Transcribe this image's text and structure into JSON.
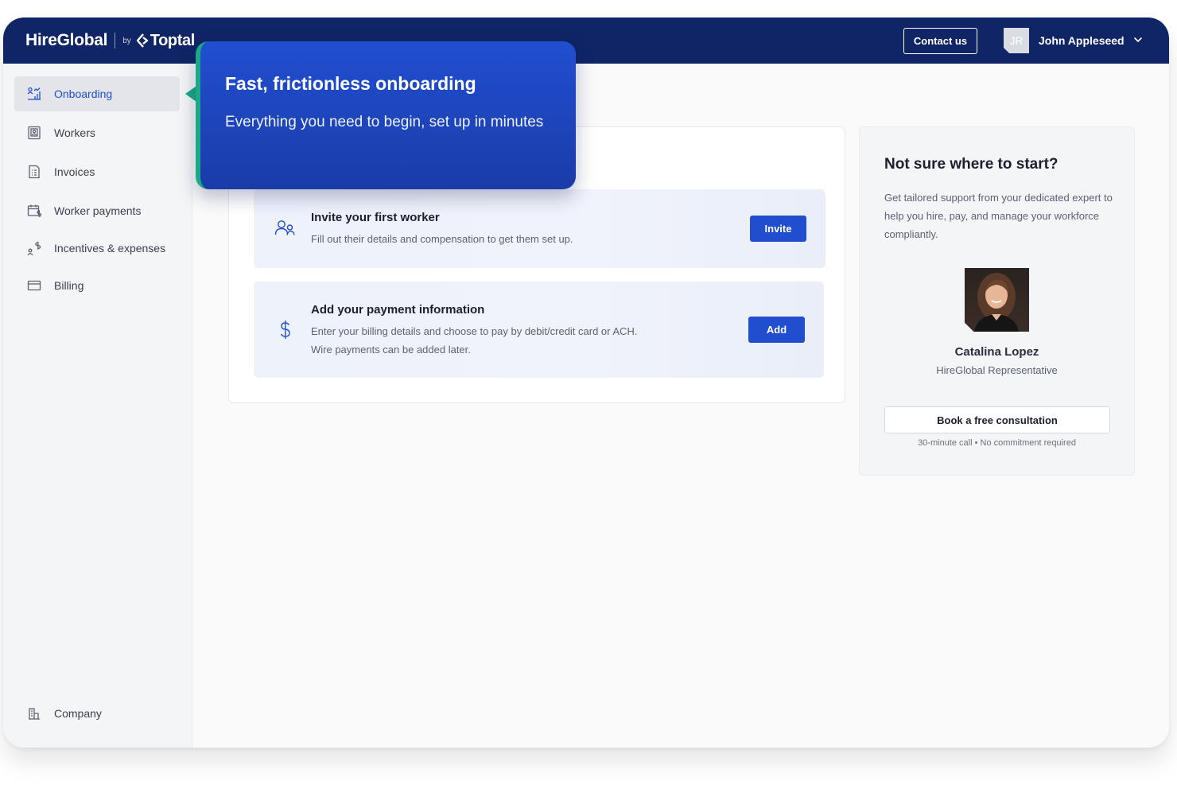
{
  "header": {
    "brand": "HireGlobal",
    "by": "by",
    "partner": "Toptal",
    "contact_label": "Contact us",
    "avatar_initials": "JR",
    "user_name": "John Appleseed"
  },
  "sidebar": {
    "items": [
      {
        "label": "Onboarding",
        "icon": "onboarding-chart-icon",
        "active": true
      },
      {
        "label": "Workers",
        "icon": "workers-id-icon"
      },
      {
        "label": "Invoices",
        "icon": "invoice-document-icon"
      },
      {
        "label": "Worker payments",
        "icon": "calendar-dollar-icon"
      },
      {
        "label": "Incentives & expenses",
        "icon": "person-dollar-icon"
      },
      {
        "label": "Billing",
        "icon": "credit-card-icon"
      }
    ],
    "footer_item": {
      "label": "Company",
      "icon": "building-icon"
    }
  },
  "tooltip": {
    "title": "Fast, frictionless onboarding",
    "body": "Everything you need to begin, set up in minutes",
    "accent_color": "#1aa886"
  },
  "tasks": [
    {
      "title": "Invite your first worker",
      "description": "Fill out their details and compensation to get them set up.",
      "button": "Invite",
      "icon": "invite-users-icon"
    },
    {
      "title": "Add your payment information",
      "description_lines": [
        "Enter your billing details and choose to pay by debit/credit card or ACH.",
        "Wire payments can be added later."
      ],
      "button": "Add",
      "icon": "dollar-icon"
    }
  ],
  "support": {
    "title": "Not sure where to start?",
    "description": "Get tailored support from your dedicated expert to help you hire, pay, and manage your workforce compliantly.",
    "rep_name": "Catalina Lopez",
    "rep_role": "HireGlobal Representative",
    "cta": "Book a free consultation",
    "note": "30-minute call • No commitment required"
  },
  "colors": {
    "header_bg": "#0f2565",
    "primary": "#204ecf",
    "accent": "#1aa886"
  }
}
